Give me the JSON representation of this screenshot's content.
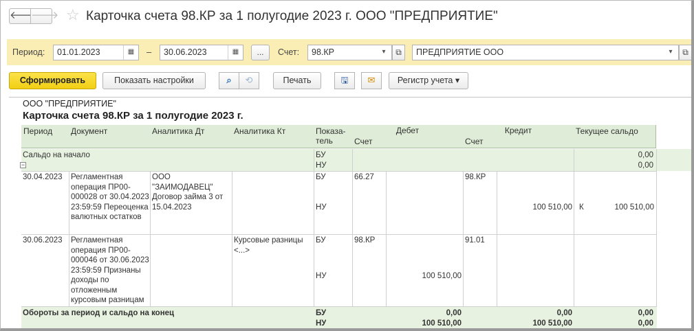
{
  "window": {
    "title": "Карточка счета 98.КР за 1 полугодие 2023 г. ООО \"ПРЕДПРИЯТИЕ\"",
    "back_glyph": "🡐",
    "forward_glyph": "🡒",
    "star_glyph": "☆"
  },
  "filters": {
    "period_label": "Период:",
    "date_from": "01.01.2023",
    "dash": "–",
    "date_to": "30.06.2023",
    "ellipsis": "...",
    "account_label": "Счет:",
    "account": "98.КР",
    "organization": "ПРЕДПРИЯТИЕ ООО"
  },
  "toolbar": {
    "generate": "Сформировать",
    "show_settings": "Показать настройки",
    "print": "Печать",
    "register": "Регистр учета"
  },
  "report": {
    "org": "ООО \"ПРЕДПРИЯТИЕ\"",
    "title": "Карточка счета 98.КР за 1 полугодие 2023 г.",
    "headers": {
      "period": "Период",
      "document": "Документ",
      "analytics_dt": "Аналитика Дт",
      "analytics_kt": "Аналитика Кт",
      "indicator": "Показа-\nтель",
      "debit": "Дебет",
      "credit": "Кредит",
      "current_balance": "Текущее сальдо",
      "debit_account": "Счет",
      "credit_account": "Счет"
    },
    "opening": {
      "label": "Сальдо на начало",
      "bu": "БУ",
      "nu": "НУ",
      "balance_bu": "0,00",
      "balance_nu": "0,00"
    },
    "rows": [
      {
        "period": "30.04.2023",
        "document": "Регламентная операция ПР00-000028 от 30.04.2023 23:59:59 Переоценка валютных остатков",
        "analytics_dt": "ООО \"ЗАИМОДАВЕЦ\" Договор займа 3 от 15.04.2023",
        "analytics_kt": "",
        "bu": "БУ",
        "nu": "НУ",
        "debit_account": "66.27",
        "debit_amount": "",
        "credit_account": "98.КР",
        "credit_amount": "100 510,00",
        "balance_side": "К",
        "balance": "100 510,00"
      },
      {
        "period": "30.06.2023",
        "document": "Регламентная операция ПР00-000046 от 30.06.2023 23:59:59 Признаны доходы по отложенным курсовым разницам",
        "analytics_dt": "",
        "analytics_kt": "Курсовые разницы <...>",
        "bu": "БУ",
        "nu": "НУ",
        "debit_account": "98.КР",
        "debit_amount": "100 510,00",
        "credit_account": "91.01",
        "credit_amount": "",
        "balance_side": "",
        "balance": ""
      }
    ],
    "totals": {
      "label": "Обороты за период и сальдо на конец",
      "bu": "БУ",
      "nu": "НУ",
      "debit_bu": "0,00",
      "debit_nu": "100 510,00",
      "credit_bu": "0,00",
      "credit_nu": "100 510,00",
      "balance_bu": "0,00",
      "balance_nu": "0,00"
    }
  }
}
